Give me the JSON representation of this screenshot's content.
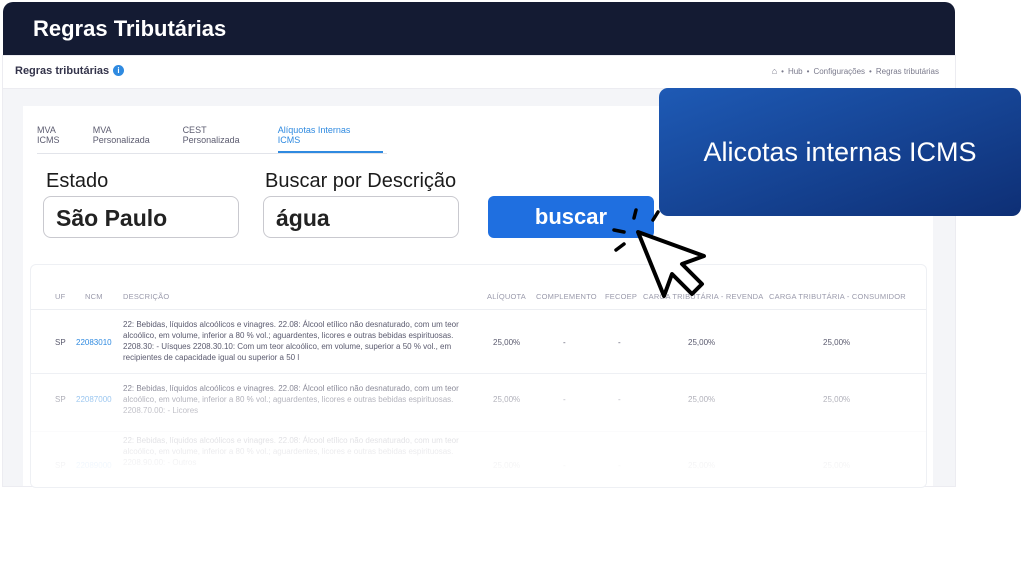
{
  "topbar": {
    "title": "Regras Tributárias"
  },
  "subheader": {
    "title": "Regras tributárias",
    "info_icon": "info-icon",
    "breadcrumb": [
      "Hub",
      "Configurações",
      "Regras tributárias"
    ]
  },
  "tabs": [
    {
      "label": "MVA ICMS",
      "active": false
    },
    {
      "label": "MVA Personalizada",
      "active": false
    },
    {
      "label": "CEST Personalizada",
      "active": false
    },
    {
      "label": "Alíquotas Internas ICMS",
      "active": true
    }
  ],
  "filters": {
    "estado_label": "Estado",
    "estado_value": "São Paulo",
    "descricao_label": "Buscar por Descrição",
    "descricao_value": "água",
    "search_button": "buscar"
  },
  "banner": {
    "text": "Alicotas internas ICMS"
  },
  "table": {
    "columns": [
      "UF",
      "NCM",
      "DESCRIÇÃO",
      "ALÍQUOTA",
      "COMPLEMENTO",
      "FECOEP",
      "CARGA TRIBUTÁRIA - REVENDA",
      "CARGA TRIBUTÁRIA - CONSUMIDOR"
    ],
    "rows": [
      {
        "uf": "SP",
        "ncm": "22083010",
        "descricao": "22: Bebidas, líquidos alcoólicos e vinagres. 22.08: Álcool etílico não desnaturado, com um teor alcoólico, em volume, inferior a 80 % vol.; aguardentes, licores e outras bebidas espirituosas. 2208.30: - Uísques 2208.30.10: Com um teor alcoólico, em volume, superior a 50 % vol., em recipientes de capacidade igual ou superior a 50 l",
        "aliquota": "25,00%",
        "complemento": "-",
        "fecoep": "-",
        "carga_revenda": "25,00%",
        "carga_consumidor": "25,00%"
      },
      {
        "uf": "SP",
        "ncm": "22087000",
        "descricao": "22: Bebidas, líquidos alcoólicos e vinagres. 22.08: Álcool etílico não desnaturado, com um teor alcoólico, em volume, inferior a 80 % vol.; aguardentes, licores e outras bebidas espirituosas. 2208.70.00: - Licores",
        "aliquota": "25,00%",
        "complemento": "-",
        "fecoep": "-",
        "carga_revenda": "25,00%",
        "carga_consumidor": "25,00%"
      },
      {
        "uf": "SP",
        "ncm": "22089000",
        "descricao": "22: Bebidas, líquidos alcoólicos e vinagres. 22.08: Álcool etílico não desnaturado, com um teor alcoólico, em volume, inferior a 80 % vol.; aguardentes, licores e outras bebidas espirituosas. 2208.90.00: - Outros",
        "aliquota": "25,00%",
        "complemento": "-",
        "fecoep": "-",
        "carga_revenda": "25,00%",
        "carga_consumidor": "25,00%"
      }
    ]
  },
  "colors": {
    "dark_header": "#141b33",
    "accent": "#2f8ae0",
    "button": "#1f6fe0",
    "banner": "#0e2f75"
  }
}
